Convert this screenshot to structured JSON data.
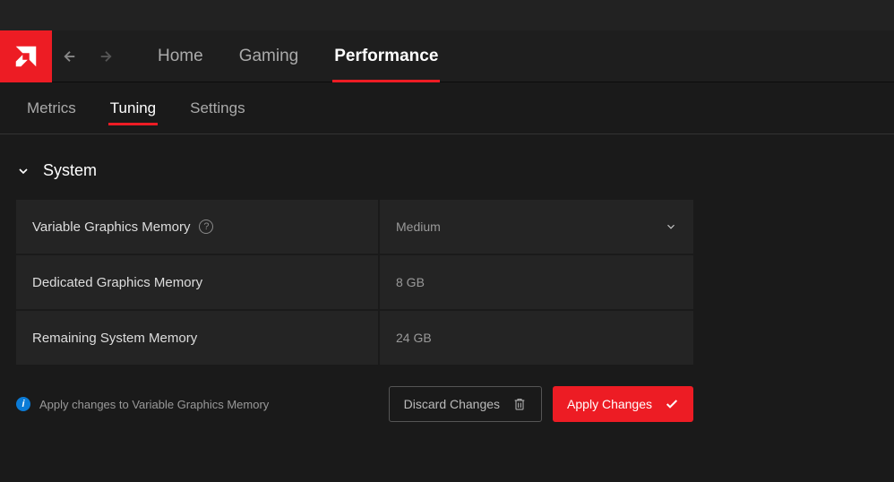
{
  "nav": {
    "main_tabs": [
      "Home",
      "Gaming",
      "Performance"
    ],
    "main_active": 2,
    "sub_tabs": [
      "Metrics",
      "Tuning",
      "Settings"
    ],
    "sub_active": 1
  },
  "section": {
    "title": "System",
    "rows": [
      {
        "label": "Variable Graphics Memory",
        "value": "Medium",
        "has_help": true,
        "dropdown": true
      },
      {
        "label": "Dedicated Graphics Memory",
        "value": "8 GB",
        "has_help": false,
        "dropdown": false
      },
      {
        "label": "Remaining System Memory",
        "value": "24 GB",
        "has_help": false,
        "dropdown": false
      }
    ]
  },
  "footer": {
    "info": "Apply changes to Variable Graphics Memory",
    "discard": "Discard Changes",
    "apply": "Apply Changes"
  }
}
